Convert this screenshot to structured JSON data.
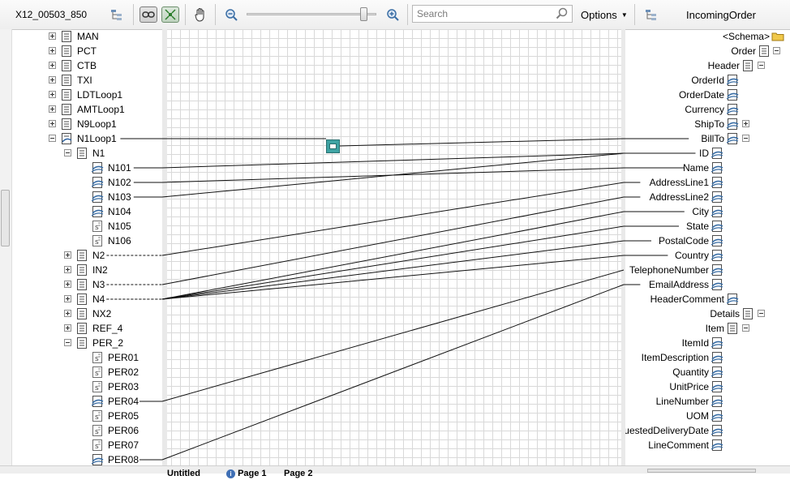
{
  "toolbar": {
    "source_schema": "X12_00503_850",
    "search_placeholder": "Search",
    "options_label": "Options",
    "target_schema": "IncomingOrder",
    "zoom": 0.9
  },
  "source_tree": [
    {
      "label": "MAN",
      "expander": "plus",
      "icon": "record"
    },
    {
      "label": "PCT",
      "expander": "plus",
      "icon": "record"
    },
    {
      "label": "CTB",
      "expander": "plus",
      "icon": "record"
    },
    {
      "label": "TXI",
      "expander": "plus",
      "icon": "record"
    },
    {
      "label": "LDTLoop1",
      "expander": "plus",
      "icon": "record"
    },
    {
      "label": "AMTLoop1",
      "expander": "plus",
      "icon": "record"
    },
    {
      "label": "N9Loop1",
      "expander": "plus",
      "icon": "record"
    },
    {
      "label": "N1Loop1",
      "expander": "minus",
      "icon": "linked-record"
    },
    {
      "label": "N1",
      "expander": "minus",
      "icon": "record"
    },
    {
      "label": "N101",
      "expander": "",
      "icon": "linked-field"
    },
    {
      "label": "N102",
      "expander": "",
      "icon": "linked-field"
    },
    {
      "label": "N103",
      "expander": "",
      "icon": "linked-field"
    },
    {
      "label": "N104",
      "expander": "",
      "icon": "linked-field"
    },
    {
      "label": "N105",
      "expander": "",
      "icon": "field"
    },
    {
      "label": "N106",
      "expander": "",
      "icon": "field"
    },
    {
      "label": "N2",
      "expander": "plus",
      "icon": "record"
    },
    {
      "label": "IN2",
      "expander": "plus",
      "icon": "record"
    },
    {
      "label": "N3",
      "expander": "plus",
      "icon": "record"
    },
    {
      "label": "N4",
      "expander": "plus",
      "icon": "record"
    },
    {
      "label": "NX2",
      "expander": "plus",
      "icon": "record"
    },
    {
      "label": "REF_4",
      "expander": "plus",
      "icon": "record"
    },
    {
      "label": "PER_2",
      "expander": "minus",
      "icon": "record"
    },
    {
      "label": "PER01",
      "expander": "",
      "icon": "field"
    },
    {
      "label": "PER02",
      "expander": "",
      "icon": "field"
    },
    {
      "label": "PER03",
      "expander": "",
      "icon": "field"
    },
    {
      "label": "PER04",
      "expander": "",
      "icon": "linked-field"
    },
    {
      "label": "PER05",
      "expander": "",
      "icon": "field"
    },
    {
      "label": "PER06",
      "expander": "",
      "icon": "field"
    },
    {
      "label": "PER07",
      "expander": "",
      "icon": "field"
    },
    {
      "label": "PER08",
      "expander": "",
      "icon": "linked-field"
    }
  ],
  "target_tree": [
    {
      "label": "<Schema>",
      "expander": "",
      "icon": "folder"
    },
    {
      "label": "Order",
      "expander": "minus",
      "icon": "record"
    },
    {
      "label": "Header",
      "expander": "minus",
      "icon": "record"
    },
    {
      "label": "OrderId",
      "expander": "",
      "icon": "linked-field"
    },
    {
      "label": "OrderDate",
      "expander": "",
      "icon": "linked-field"
    },
    {
      "label": "Currency",
      "expander": "",
      "icon": "linked-field"
    },
    {
      "label": "ShipTo",
      "expander": "plus",
      "icon": "linked-field"
    },
    {
      "label": "BillTo",
      "expander": "minus",
      "icon": "linked-field"
    },
    {
      "label": "ID",
      "expander": "",
      "icon": "linked-field"
    },
    {
      "label": "Name",
      "expander": "",
      "icon": "linked-field"
    },
    {
      "label": "AddressLine1",
      "expander": "",
      "icon": "linked-field"
    },
    {
      "label": "AddressLine2",
      "expander": "",
      "icon": "linked-field"
    },
    {
      "label": "City",
      "expander": "",
      "icon": "linked-field"
    },
    {
      "label": "State",
      "expander": "",
      "icon": "linked-field"
    },
    {
      "label": "PostalCode",
      "expander": "",
      "icon": "linked-field"
    },
    {
      "label": "Country",
      "expander": "",
      "icon": "linked-field"
    },
    {
      "label": "TelephoneNumber",
      "expander": "",
      "icon": "linked-field"
    },
    {
      "label": "EmailAddress",
      "expander": "",
      "icon": "linked-field"
    },
    {
      "label": "HeaderComment",
      "expander": "",
      "icon": "linked-field"
    },
    {
      "label": "Details",
      "expander": "minus",
      "icon": "record"
    },
    {
      "label": "Item",
      "expander": "minus",
      "icon": "record"
    },
    {
      "label": "ItemId",
      "expander": "",
      "icon": "linked-field"
    },
    {
      "label": "ItemDescription",
      "expander": "",
      "icon": "linked-field"
    },
    {
      "label": "Quantity",
      "expander": "",
      "icon": "linked-field"
    },
    {
      "label": "UnitPrice",
      "expander": "",
      "icon": "linked-field"
    },
    {
      "label": "LineNumber",
      "expander": "",
      "icon": "linked-field"
    },
    {
      "label": "UOM",
      "expander": "",
      "icon": "linked-field"
    },
    {
      "label": "RequestedDeliveryDate",
      "expander": "",
      "icon": "linked-field"
    },
    {
      "label": "LineComment",
      "expander": "",
      "icon": "linked-field"
    }
  ],
  "links": [
    {
      "from": "N1Loop1",
      "to": "BillTo",
      "via_functoid": true
    },
    {
      "from": "N101",
      "to": "ID"
    },
    {
      "from": "N102",
      "to": "Name"
    },
    {
      "from": "N103",
      "to": "ID"
    },
    {
      "from": "N2",
      "to": "AddressLine1"
    },
    {
      "from": "N3",
      "to": "AddressLine2"
    },
    {
      "from": "N4",
      "to": "City"
    },
    {
      "from": "N4",
      "to": "State"
    },
    {
      "from": "N4",
      "to": "PostalCode"
    },
    {
      "from": "N4",
      "to": "Country"
    },
    {
      "from": "PER04",
      "to": "TelephoneNumber"
    },
    {
      "from": "PER08",
      "to": "EmailAddress"
    }
  ],
  "tabs": [
    "Untitled",
    "Page 1",
    "Page 2"
  ]
}
